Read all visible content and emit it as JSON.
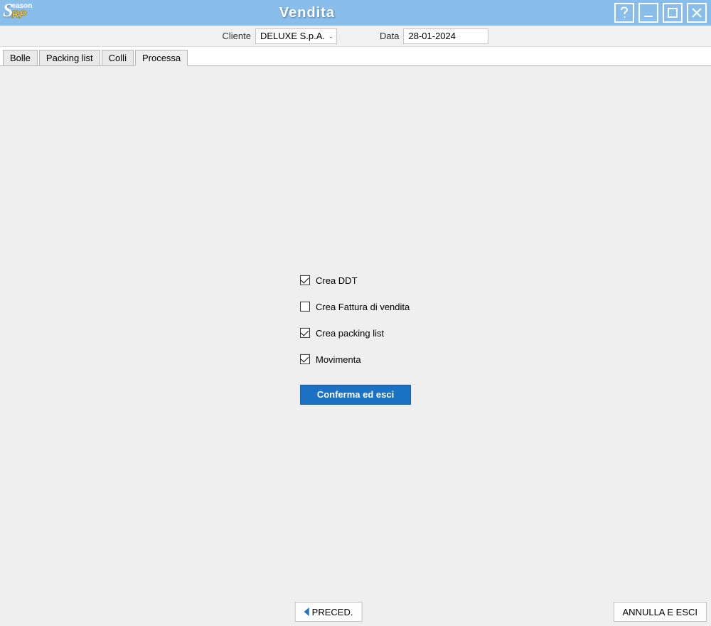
{
  "app": {
    "logo_eason": "eason",
    "logo_rp": "RP"
  },
  "window": {
    "title": "Vendita"
  },
  "header": {
    "cliente_label": "Cliente",
    "cliente_value": "DELUXE S.p.A.",
    "data_label": "Data",
    "data_value": "28-01-2024"
  },
  "tabs": {
    "bolle": "Bolle",
    "packing": "Packing list",
    "colli": "Colli",
    "processa": "Processa",
    "active": "processa"
  },
  "processa": {
    "options": [
      {
        "key": "crea_ddt",
        "label": "Crea DDT",
        "checked": true
      },
      {
        "key": "crea_fattura",
        "label": "Crea Fattura di vendita",
        "checked": false
      },
      {
        "key": "crea_packing",
        "label": "Crea packing list",
        "checked": true
      },
      {
        "key": "movimenta",
        "label": "Movimenta",
        "checked": true
      }
    ],
    "confirm_label": "Conferma ed esci"
  },
  "footer": {
    "prev_label": "PRECED.",
    "cancel_label": "ANNULLA E ESCI"
  }
}
